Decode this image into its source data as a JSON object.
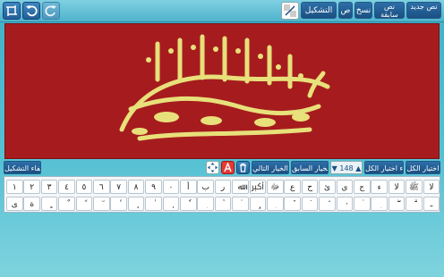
{
  "topbar": {
    "new_text_label": "نص جديد",
    "saved_text_label": "نص سابقة",
    "copy_label": "نسخ",
    "paste_label": "ص",
    "tashkeel_label": "التشكيل"
  },
  "toolbar": {
    "select_all": "اختيار الكل",
    "cancel_select_all": "الغاء اختيار الكل",
    "count": "148",
    "prev": "الخيار السابق",
    "next": "الخيار التالي",
    "hide_tashkeel": "إخفاء التشكيل"
  },
  "keyboard": {
    "row1": [
      "١",
      "٢",
      "٣",
      "٤",
      "٥",
      "٦",
      "٧",
      "٨",
      "٩",
      "٠",
      "أ",
      "ب",
      "ر",
      "ﷲ",
      "ﷳ",
      "ﷻ",
      "ع",
      "ح",
      "ئ",
      "ي",
      "ج",
      "ء",
      "ﻻ",
      "ﷺ",
      "لا"
    ],
    "row2": [
      "ى",
      "ة",
      "ٍ",
      "ٌ",
      "ً",
      "ٓ",
      "ٔ",
      "ٕ",
      "ٰ",
      "ٖ",
      "ٗ",
      "ٜ",
      "ٝ",
      "ٞ",
      "ٟ",
      "ٜ",
      "ٚ",
      "ٙ",
      "٘",
      "ٛ",
      "ٞ",
      "ٜ",
      "ۖ",
      "ۗ",
      "ـ"
    ]
  },
  "colors": {
    "canvas_bg": "#a61c1e",
    "calligraphy": "#e8e07a"
  },
  "icons": [
    "redo-icon",
    "undo-icon",
    "crop-icon",
    "background-icon",
    "move-icon",
    "text-color-icon",
    "delete-icon"
  ]
}
